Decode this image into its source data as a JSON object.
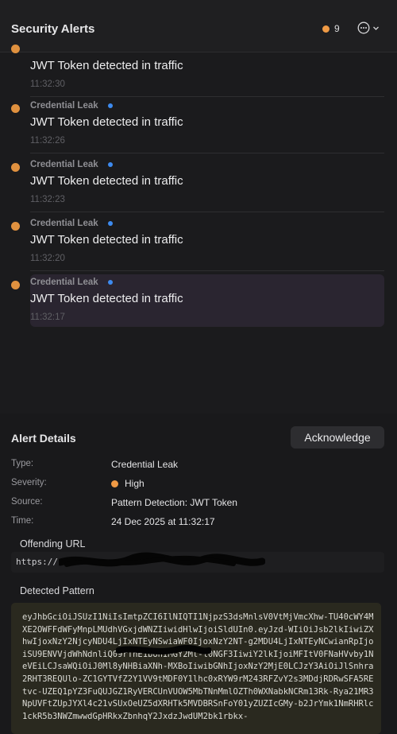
{
  "header": {
    "title": "Security Alerts",
    "alert_count": "9"
  },
  "alerts": [
    {
      "category": "",
      "message": "JWT Token detected in traffic",
      "time": "11:32:30"
    },
    {
      "category": "Credential Leak",
      "message": "JWT Token detected in traffic",
      "time": "11:32:26"
    },
    {
      "category": "Credential Leak",
      "message": "JWT Token detected in traffic",
      "time": "11:32:23"
    },
    {
      "category": "Credential Leak",
      "message": "JWT Token detected in traffic",
      "time": "11:32:20"
    },
    {
      "category": "Credential Leak",
      "message": "JWT Token detected in traffic",
      "time": "11:32:17"
    }
  ],
  "details": {
    "title": "Alert Details",
    "acknowledge_label": "Acknowledge",
    "fields": [
      {
        "key": "Type:",
        "value": "Credential Leak"
      },
      {
        "key": "Severity:",
        "value": "High"
      },
      {
        "key": "Source:",
        "value": "Pattern Detection: JWT Token"
      },
      {
        "key": "Time:",
        "value": "24 Dec 2025 at 11:32:17"
      }
    ],
    "offending_url_label": "Offending URL",
    "offending_url_value": "https://",
    "detected_pattern_label": "Detected Pattern",
    "detected_pattern": "eyJhbGciOiJSUzI1NiIsImtpZCI6IlNIQTI1NjpzS3dsMnlsV0VtMjVmcXhw-TU40cWY4MXE2OWFFdWFyMnpLMUdhVGxjdWNZIiwidHlwIjoiSldUIn0.eyJzd-WIiOiJsb2lkIiwiZXhwIjoxNzY2NjcyNDU4LjIxNTEyNSwiaWF0IjoxNzY2NT-g2MDU4LjIxNTEyNCwianRpIjoiSU9ENVVjdWhNdnliQ09rTnE1bUhIMGY2Ml-l0NGF3IiwiY2lkIjoiMFItV0FNaHVvby1NeVEiLCJsaWQiOiJ0Ml8yNHBiaXNh-MXBoIiwibGNhIjoxNzY2MjE0LCJzY3AiOiJlSnhra2RHT3REQUlo-ZC1GYTVfZ2Y1VV9tMDF0Y1lhc0xRYW9rM243RFZvY2s3MDdjRDRwSFA5REtvc-UZEQ1pYZ3FuQUJGZ1RyVERCUnVUOW5MbTNnMmlOZTh0WXNabkNCRm13Rk-Rya21MR3NpUVFtZUpJYXl4c21vSUxOeUZ5dXRHTk5MVDBRSnFoY01yZUZIcGMy-b2JrYmk1NmRHRlc1ckR5b3NWZmwwdGpHRkxZbnhqY2JxdzJwdUM2bk1rbkx-",
    "severity_color": "#ef9a45",
    "unread_color": "#3d8bf0"
  }
}
